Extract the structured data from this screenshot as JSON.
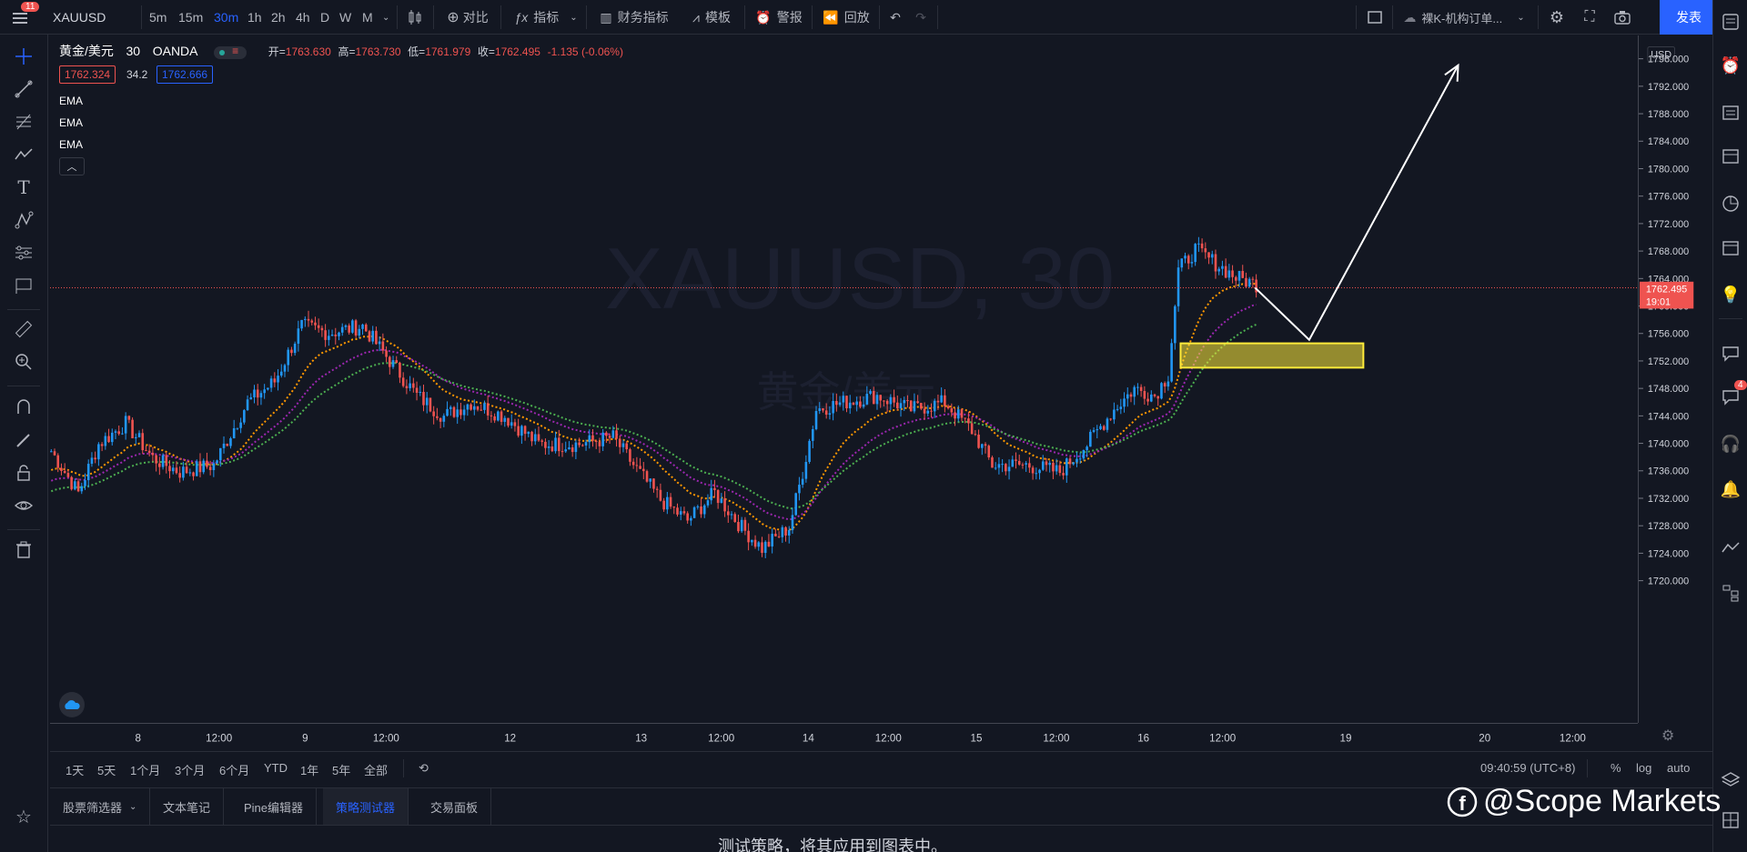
{
  "topbar": {
    "menu_badge": "11",
    "symbol": "XAUUSD",
    "intervals": [
      "5m",
      "15m",
      "30m",
      "1h",
      "2h",
      "4h",
      "D",
      "W",
      "M"
    ],
    "active_interval": "30m",
    "compare_label": "对比",
    "indicators_label": "指标",
    "financials_label": "财务指标",
    "templates_label": "模板",
    "alert_label": "警报",
    "replay_label": "回放",
    "layout_name": "裸K-机构订单...",
    "publish_label": "发表"
  },
  "legend": {
    "title": "黄金/美元",
    "interval": "30",
    "source": "OANDA",
    "open_label": "开=",
    "open": "1763.630",
    "high_label": "高=",
    "high": "1763.730",
    "low_label": "低=",
    "low": "1761.979",
    "close_label": "收=",
    "close": "1762.495",
    "change": "-1.135 (-0.06%)",
    "bid": "1762.324",
    "spread": "34.2",
    "ask": "1762.666",
    "indicators": [
      "EMA",
      "EMA",
      "EMA"
    ]
  },
  "watermark": {
    "symbol": "XAUUSD, 30",
    "description": "黄金/美元"
  },
  "price_scale": {
    "currency": "USD",
    "current_price": "1762.495",
    "countdown": "19:01",
    "ticks": [
      "1796.000",
      "1792.000",
      "1788.000",
      "1784.000",
      "1780.000",
      "1776.000",
      "1772.000",
      "1768.000",
      "1764.000",
      "1760.000",
      "1756.000",
      "1752.000",
      "1748.000",
      "1744.000",
      "1740.000",
      "1736.000",
      "1732.000",
      "1728.000",
      "1724.000",
      "1720.000"
    ]
  },
  "time_scale": {
    "labels": [
      "8",
      "12:00",
      "9",
      "12:00",
      "12",
      "13",
      "12:00",
      "14",
      "12:00",
      "15",
      "12:00",
      "16",
      "12:00",
      "19",
      "20",
      "12:00"
    ]
  },
  "range_bar": {
    "ranges": [
      "1天",
      "5天",
      "1个月",
      "3个月",
      "6个月",
      "YTD",
      "1年",
      "5年",
      "全部"
    ],
    "clock": "09:40:59 (UTC+8)",
    "percent": "%",
    "log": "log",
    "auto": "auto"
  },
  "bottom_panel": {
    "tabs": [
      "股票筛选器",
      "文本笔记",
      "Pine编辑器",
      "策略测试器",
      "交易面板"
    ],
    "active_tab": "策略测试器",
    "message": "测试策略，将其应用到图表中。"
  },
  "right_badge": "4",
  "brand_watermark": "@Scope Markets",
  "colors": {
    "background": "#131722",
    "up": "#2196f3",
    "down": "#ef5350",
    "ema_fast": "#ff9800",
    "ema_mid": "#9c27b0",
    "ema_slow": "#4caf50",
    "zone": "#ffeb3b",
    "accent": "#2962ff"
  },
  "chart_data": {
    "type": "candlestick",
    "symbol": "XAUUSD",
    "timeframe": "30",
    "ylim": [
      1719,
      1798
    ],
    "price_anchors": [
      {
        "t": 0,
        "p": 1739
      },
      {
        "t": 8,
        "p": 1733
      },
      {
        "t": 14,
        "p": 1740
      },
      {
        "t": 22,
        "p": 1743
      },
      {
        "t": 30,
        "p": 1738
      },
      {
        "t": 38,
        "p": 1736
      },
      {
        "t": 48,
        "p": 1737
      },
      {
        "t": 58,
        "p": 1746
      },
      {
        "t": 66,
        "p": 1749
      },
      {
        "t": 74,
        "p": 1757
      },
      {
        "t": 82,
        "p": 1756
      },
      {
        "t": 92,
        "p": 1757
      },
      {
        "t": 100,
        "p": 1752
      },
      {
        "t": 108,
        "p": 1747
      },
      {
        "t": 116,
        "p": 1744
      },
      {
        "t": 124,
        "p": 1746
      },
      {
        "t": 134,
        "p": 1744
      },
      {
        "t": 144,
        "p": 1740
      },
      {
        "t": 156,
        "p": 1740
      },
      {
        "t": 166,
        "p": 1741
      },
      {
        "t": 172,
        "p": 1737
      },
      {
        "t": 180,
        "p": 1732
      },
      {
        "t": 188,
        "p": 1729
      },
      {
        "t": 196,
        "p": 1733
      },
      {
        "t": 204,
        "p": 1728
      },
      {
        "t": 210,
        "p": 1725
      },
      {
        "t": 218,
        "p": 1728
      },
      {
        "t": 222,
        "p": 1736
      },
      {
        "t": 226,
        "p": 1745
      },
      {
        "t": 234,
        "p": 1746
      },
      {
        "t": 244,
        "p": 1747
      },
      {
        "t": 254,
        "p": 1745
      },
      {
        "t": 264,
        "p": 1746
      },
      {
        "t": 272,
        "p": 1742
      },
      {
        "t": 278,
        "p": 1737
      },
      {
        "t": 288,
        "p": 1737
      },
      {
        "t": 298,
        "p": 1736
      },
      {
        "t": 306,
        "p": 1740
      },
      {
        "t": 314,
        "p": 1745
      },
      {
        "t": 320,
        "p": 1748
      },
      {
        "t": 326,
        "p": 1747
      },
      {
        "t": 330,
        "p": 1750
      },
      {
        "t": 333,
        "p": 1765
      },
      {
        "t": 338,
        "p": 1768
      },
      {
        "t": 344,
        "p": 1766
      },
      {
        "t": 350,
        "p": 1764
      },
      {
        "t": 356,
        "p": 1763
      }
    ],
    "candle_count": 357,
    "ema_series": [
      {
        "period_color": "#ff9800",
        "length": 20
      },
      {
        "period_color": "#9c27b0",
        "length": 35
      },
      {
        "period_color": "#4caf50",
        "length": 50
      }
    ],
    "demand_zone": {
      "t_start": 334,
      "t_end": 388,
      "price_low": 1751,
      "price_high": 1754.5
    },
    "projection": [
      {
        "t": 356,
        "p": 1762.5
      },
      {
        "t": 372,
        "p": 1755
      },
      {
        "t": 416,
        "p": 1794.5
      }
    ],
    "current_price": 1762.495
  }
}
